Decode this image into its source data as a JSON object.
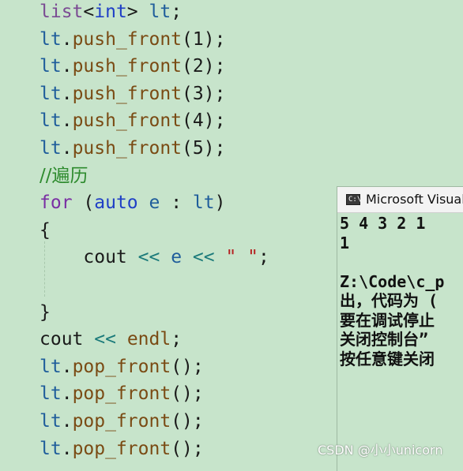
{
  "editor": {
    "lines": [
      {
        "tokens": [
          {
            "c": "type",
            "t": "list"
          },
          {
            "c": "plain",
            "t": "<"
          },
          {
            "c": "kw",
            "t": "int"
          },
          {
            "c": "plain",
            "t": "> "
          },
          {
            "c": "id",
            "t": "lt"
          },
          {
            "c": "plain",
            "t": ";"
          }
        ]
      },
      {
        "tokens": [
          {
            "c": "id",
            "t": "lt"
          },
          {
            "c": "plain",
            "t": "."
          },
          {
            "c": "fn",
            "t": "push_front"
          },
          {
            "c": "plain",
            "t": "(1);"
          }
        ]
      },
      {
        "tokens": [
          {
            "c": "id",
            "t": "lt"
          },
          {
            "c": "plain",
            "t": "."
          },
          {
            "c": "fn",
            "t": "push_front"
          },
          {
            "c": "plain",
            "t": "(2);"
          }
        ]
      },
      {
        "tokens": [
          {
            "c": "id",
            "t": "lt"
          },
          {
            "c": "plain",
            "t": "."
          },
          {
            "c": "fn",
            "t": "push_front"
          },
          {
            "c": "plain",
            "t": "(3);"
          }
        ]
      },
      {
        "tokens": [
          {
            "c": "id",
            "t": "lt"
          },
          {
            "c": "plain",
            "t": "."
          },
          {
            "c": "fn",
            "t": "push_front"
          },
          {
            "c": "plain",
            "t": "(4);"
          }
        ]
      },
      {
        "tokens": [
          {
            "c": "id",
            "t": "lt"
          },
          {
            "c": "plain",
            "t": "."
          },
          {
            "c": "fn",
            "t": "push_front"
          },
          {
            "c": "plain",
            "t": "(5);"
          }
        ]
      },
      {
        "tokens": [
          {
            "c": "comment",
            "t": "//遍历"
          }
        ]
      },
      {
        "tokens": [
          {
            "c": "kw2",
            "t": "for"
          },
          {
            "c": "plain",
            "t": " ("
          },
          {
            "c": "kw",
            "t": "auto"
          },
          {
            "c": "plain",
            "t": " "
          },
          {
            "c": "id",
            "t": "e"
          },
          {
            "c": "plain",
            "t": " : "
          },
          {
            "c": "id",
            "t": "lt"
          },
          {
            "c": "plain",
            "t": ")"
          }
        ]
      },
      {
        "tokens": [
          {
            "c": "plain",
            "t": "{"
          }
        ]
      },
      {
        "tokens": [
          {
            "c": "plain",
            "t": "    cout "
          },
          {
            "c": "op",
            "t": "<<"
          },
          {
            "c": "plain",
            "t": " "
          },
          {
            "c": "id",
            "t": "e"
          },
          {
            "c": "plain",
            "t": " "
          },
          {
            "c": "op",
            "t": "<<"
          },
          {
            "c": "plain",
            "t": " "
          },
          {
            "c": "str",
            "t": "\" \""
          },
          {
            "c": "plain",
            "t": ";"
          }
        ]
      },
      {
        "tokens": [
          {
            "c": "plain",
            "t": ""
          }
        ]
      },
      {
        "tokens": [
          {
            "c": "plain",
            "t": "}"
          }
        ]
      },
      {
        "tokens": [
          {
            "c": "plain",
            "t": "cout "
          },
          {
            "c": "op",
            "t": "<<"
          },
          {
            "c": "plain",
            "t": " "
          },
          {
            "c": "fn",
            "t": "endl"
          },
          {
            "c": "plain",
            "t": ";"
          }
        ]
      },
      {
        "tokens": [
          {
            "c": "id",
            "t": "lt"
          },
          {
            "c": "plain",
            "t": "."
          },
          {
            "c": "fn",
            "t": "pop_front"
          },
          {
            "c": "plain",
            "t": "();"
          }
        ]
      },
      {
        "tokens": [
          {
            "c": "id",
            "t": "lt"
          },
          {
            "c": "plain",
            "t": "."
          },
          {
            "c": "fn",
            "t": "pop_front"
          },
          {
            "c": "plain",
            "t": "();"
          }
        ]
      },
      {
        "tokens": [
          {
            "c": "id",
            "t": "lt"
          },
          {
            "c": "plain",
            "t": "."
          },
          {
            "c": "fn",
            "t": "pop_front"
          },
          {
            "c": "plain",
            "t": "();"
          }
        ]
      },
      {
        "tokens": [
          {
            "c": "id",
            "t": "lt"
          },
          {
            "c": "plain",
            "t": "."
          },
          {
            "c": "fn",
            "t": "pop_front"
          },
          {
            "c": "plain",
            "t": "();"
          }
        ]
      }
    ]
  },
  "console": {
    "title": "Microsoft Visual",
    "icon_label": "C:\\",
    "icon": "console-app-icon",
    "lines": [
      "5 4 3 2 1",
      "1",
      "",
      "Z:\\Code\\c_p",
      "出，代码为 (",
      "要在调试停止",
      "关闭控制台”",
      "按任意键关闭"
    ]
  },
  "watermark": "CSDN @小小unicorn",
  "colors": {
    "background": "#c7e4cb",
    "keyword": "#1f3fc6",
    "keyword_flow": "#7a2fa3",
    "type": "#7b4b93",
    "identifier": "#1f5d9b",
    "function": "#7a4b14",
    "operator": "#1b7a7a",
    "string": "#b52020",
    "comment": "#2e8b2e"
  }
}
